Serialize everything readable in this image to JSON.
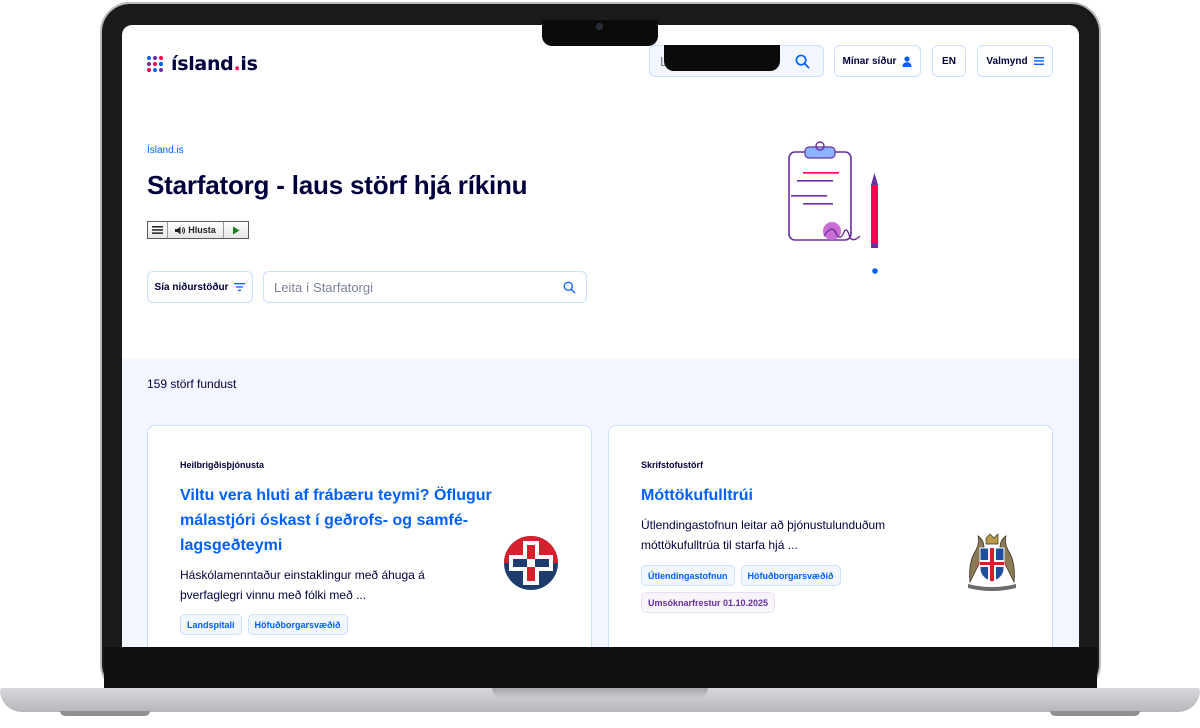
{
  "header": {
    "logo_text_main": "ísland",
    "logo_text_dot": ".",
    "logo_text_suffix": "is",
    "search_placeholder": "Leitaðu á Ísland.is",
    "my_pages_label": "Mínar síður",
    "language_label": "EN",
    "menu_label": "Valmynd"
  },
  "hero": {
    "breadcrumb": "Ísland.is",
    "title": "Starfatorg - laus störf hjá ríkinu",
    "listen_label": "Hlusta",
    "filter_label": "Sía niðurstöður",
    "job_search_placeholder": "Leita í Starfatorgi"
  },
  "results": {
    "count_text": "159 störf fundust",
    "cards": [
      {
        "category": "Heilbrigðisþjónusta",
        "title": "Viltu vera hluti af frábæru teymi? Öflugur málastjóri óskast í geðrofs- og samfé-lagsgeðteymi",
        "description": "Háskólamenntaður einstaklingur með áhuga á þverfaglegri vinnu með fólki með ...",
        "tags": [
          "Landspítali",
          "Höfuðborgarsvæðið"
        ],
        "logo_icon": "landspitali-logo-icon"
      },
      {
        "category": "Skrifstofustörf",
        "title": "Móttökufulltrúi",
        "description": "Útlendingastofnun leitar að þjónustulunduðum móttökufulltrúa til starfa hjá ...",
        "tags": [
          "Útlendingastofnun",
          "Höfuðborgarsvæðið"
        ],
        "deadline": "Umsóknarfrestur 01.10.2025",
        "logo_icon": "iceland-coat-of-arms-icon"
      }
    ]
  },
  "colors": {
    "brand_navy": "#00003c",
    "link_blue": "#0061ff",
    "accent_red": "#ff0050",
    "band_background": "#f2f7ff",
    "border_blue": "#ccdfff"
  }
}
